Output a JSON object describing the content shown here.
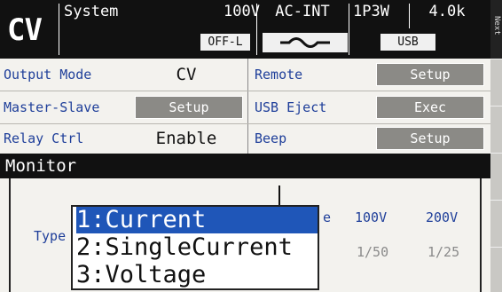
{
  "header": {
    "mode": "CV",
    "menu_title": "System",
    "voltage_range": "100V",
    "input_mode": "AC-INT",
    "phase": "1P3W",
    "frequency": "4.0k",
    "output_status": "OFF-L",
    "interface": "USB",
    "next_label": "Next"
  },
  "settings": {
    "output_mode": {
      "label": "Output Mode",
      "value": "CV"
    },
    "master_slave": {
      "label": "Master-Slave",
      "button": "Setup"
    },
    "relay_ctrl": {
      "label": "Relay Ctrl",
      "value": "Enable"
    },
    "remote": {
      "label": "Remote",
      "button": "Setup"
    },
    "usb_eject": {
      "label": "USB Eject",
      "button": "Exec"
    },
    "beep": {
      "label": "Beep",
      "button": "Setup"
    }
  },
  "monitor": {
    "title": "Monitor",
    "type_label": "Type",
    "partial_label": "e",
    "columns": [
      "100V",
      "200V"
    ],
    "ratios": [
      "1/50",
      "1/25"
    ]
  },
  "dropdown": {
    "options": [
      "1:Current",
      "2:SingleCurrent",
      "3:Voltage"
    ],
    "selected_index": 0
  },
  "colors": {
    "header_bg": "#111111",
    "label_blue": "#1f3f9a",
    "button_gray": "#8b8a86",
    "selection_blue": "#1f56b8"
  }
}
